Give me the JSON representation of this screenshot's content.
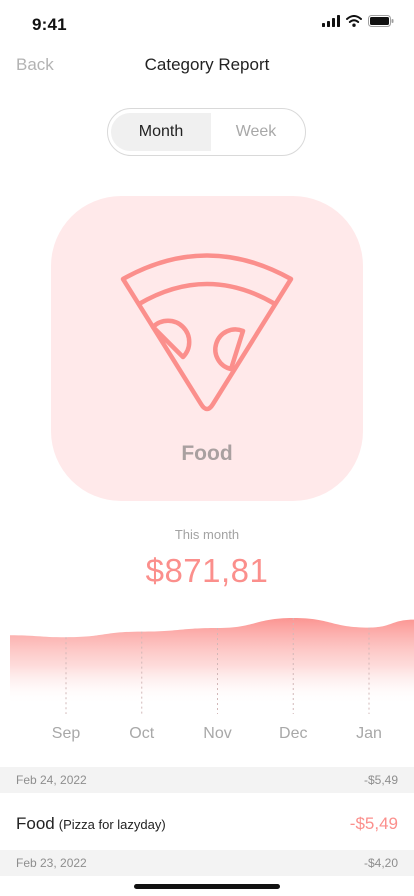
{
  "status_bar": {
    "time": "9:41",
    "icons": [
      "signal-icon",
      "wifi-icon",
      "battery-icon"
    ]
  },
  "nav": {
    "back_label": "Back",
    "title": "Category Report"
  },
  "period_toggle": {
    "options": [
      "Month",
      "Week"
    ],
    "selected": "Month"
  },
  "category": {
    "name": "Food",
    "icon": "pizza-slice-icon",
    "card_color": "#ffe9ea",
    "icon_color": "#fb8f8c"
  },
  "summary": {
    "period_label": "This month",
    "total": "$871,81"
  },
  "chart_data": {
    "type": "area",
    "categories": [
      "Sep",
      "Oct",
      "Nov",
      "Dec",
      "Jan"
    ],
    "ylim": [
      0,
      1
    ],
    "values": [
      0.52,
      0.66,
      0.75,
      1.0,
      0.76
    ],
    "color": "#fb8f8c",
    "grid": false
  },
  "transactions": {
    "groups": [
      {
        "date": "Feb 24, 2022",
        "total": "-$5,49",
        "items": [
          {
            "category": "Food",
            "note": "(Pizza for lazyday)",
            "amount": "-$5,49"
          }
        ]
      },
      {
        "date": "Feb 23, 2022",
        "total": "-$4,20",
        "items": []
      }
    ]
  },
  "colors": {
    "accent": "#fb8f8c",
    "muted_text": "#a8a8a8"
  }
}
